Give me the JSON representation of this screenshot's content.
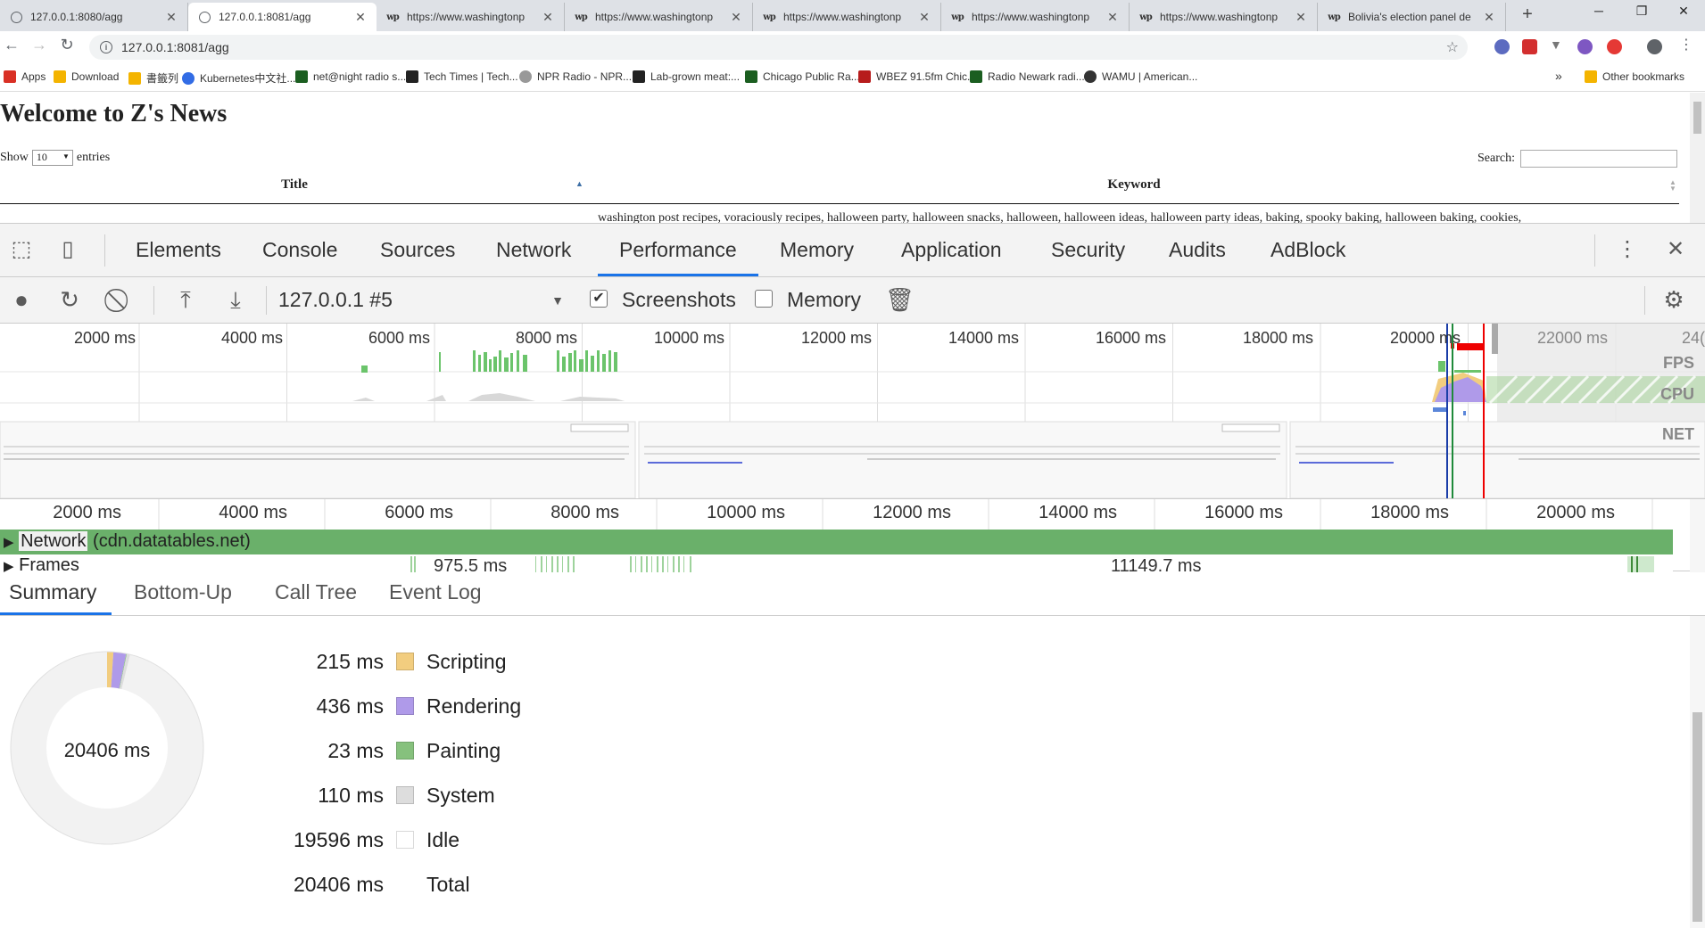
{
  "tabs": [
    {
      "label": "127.0.0.1:8080/agg",
      "icon": "globe-icon"
    },
    {
      "label": "127.0.0.1:8081/agg",
      "icon": "globe-icon",
      "active": true
    },
    {
      "label": "https://www.washingtonp",
      "icon": "washington-post-icon"
    },
    {
      "label": "https://www.washingtonp",
      "icon": "washington-post-icon"
    },
    {
      "label": "https://www.washingtonp",
      "icon": "washington-post-icon"
    },
    {
      "label": "https://www.washingtonp",
      "icon": "washington-post-icon"
    },
    {
      "label": "https://www.washingtonp",
      "icon": "washington-post-icon"
    },
    {
      "label": "Bolivia's election panel de",
      "icon": "washington-post-icon"
    }
  ],
  "favicon_text": "wp",
  "address": {
    "url": "127.0.0.1:8081/agg"
  },
  "bookmarks": [
    {
      "label": "Apps",
      "icon": "apps-grid-icon",
      "color": "#d93025"
    },
    {
      "label": "Download",
      "icon": "bookmark-icon",
      "color": "#f4b400"
    },
    {
      "label": "書籤列",
      "icon": "folder-icon",
      "color": "#f4b400"
    },
    {
      "label": "Kubernetes中文社...",
      "icon": "kubernetes-icon",
      "color": "#326ce5"
    },
    {
      "label": "net@night radio s...",
      "icon": "terminal-icon",
      "color": "#1b5e20"
    },
    {
      "label": "Tech Times | Tech...",
      "icon": "tech-times-icon",
      "color": "#222222"
    },
    {
      "label": "NPR Radio - NPR...",
      "icon": "npr-icon",
      "color": "#999999"
    },
    {
      "label": "Lab-grown meat:...",
      "icon": "blog-icon",
      "color": "#222222"
    },
    {
      "label": "Chicago Public Ra...",
      "icon": "terminal-icon",
      "color": "#1b5e20"
    },
    {
      "label": "WBEZ 91.5fm Chic...",
      "icon": "wbez-icon",
      "color": "#b71c1c"
    },
    {
      "label": "Radio Newark radi...",
      "icon": "terminal-icon",
      "color": "#1b5e20"
    },
    {
      "label": "WAMU | American...",
      "icon": "wamu-icon",
      "color": "#333333"
    }
  ],
  "bookmarks_more": "»",
  "other_bookmarks": "Other bookmarks",
  "page": {
    "heading": "Welcome to Z's News",
    "show_label": "Show",
    "show_value": "10",
    "entries_label": "entries",
    "search_label": "Search:",
    "col_title": "Title",
    "col_keyword": "Keyword",
    "row1_keyword": "washington post recipes, voraciously recipes, halloween party, halloween snacks, halloween, halloween ideas, halloween party ideas, baking, spooky baking, halloween baking, cookies,"
  },
  "devtools": {
    "tabs": [
      "Elements",
      "Console",
      "Sources",
      "Network",
      "Performance",
      "Memory",
      "Application",
      "Security",
      "Audits",
      "AdBlock"
    ],
    "active_tab": "Performance",
    "profile": "127.0.0.1 #5",
    "screenshots_label": "Screenshots",
    "screenshots_checked": true,
    "memory_label": "Memory",
    "memory_checked": false,
    "overview_ticks": [
      "2000 ms",
      "4000 ms",
      "6000 ms",
      "8000 ms",
      "10000 ms",
      "12000 ms",
      "14000 ms",
      "16000 ms",
      "18000 ms",
      "20000 ms",
      "22000 ms",
      "24("
    ],
    "overview_labels": [
      "FPS",
      "CPU",
      "NET"
    ],
    "thumb_heading": "Welcome to Z's News",
    "flame_ticks": [
      "2000 ms",
      "4000 ms",
      "6000 ms",
      "8000 ms",
      "10000 ms",
      "12000 ms",
      "14000 ms",
      "16000 ms",
      "18000 ms",
      "20000 ms"
    ],
    "network_label": "Network",
    "network_host": "(cdn.datatables.net)",
    "frames_label": "Frames",
    "frame_values": [
      "975.5 ms",
      "11149.7 ms"
    ],
    "summary_tabs": [
      "Summary",
      "Bottom-Up",
      "Call Tree",
      "Event Log"
    ],
    "summary_active": "Summary",
    "summary": {
      "total_center": "20406 ms",
      "rows": [
        {
          "value": "215 ms",
          "label": "Scripting",
          "color": "#f2cd7f",
          "ms": 215
        },
        {
          "value": "436 ms",
          "label": "Rendering",
          "color": "#af9ae9",
          "ms": 436
        },
        {
          "value": "23 ms",
          "label": "Painting",
          "color": "#86c17d",
          "ms": 23
        },
        {
          "value": "110 ms",
          "label": "System",
          "color": "#dddddd",
          "ms": 110
        },
        {
          "value": "19596 ms",
          "label": "Idle",
          "color": "#ffffff",
          "ms": 19596
        },
        {
          "value": "20406 ms",
          "label": "Total",
          "color": "",
          "ms": 20406
        }
      ]
    }
  }
}
